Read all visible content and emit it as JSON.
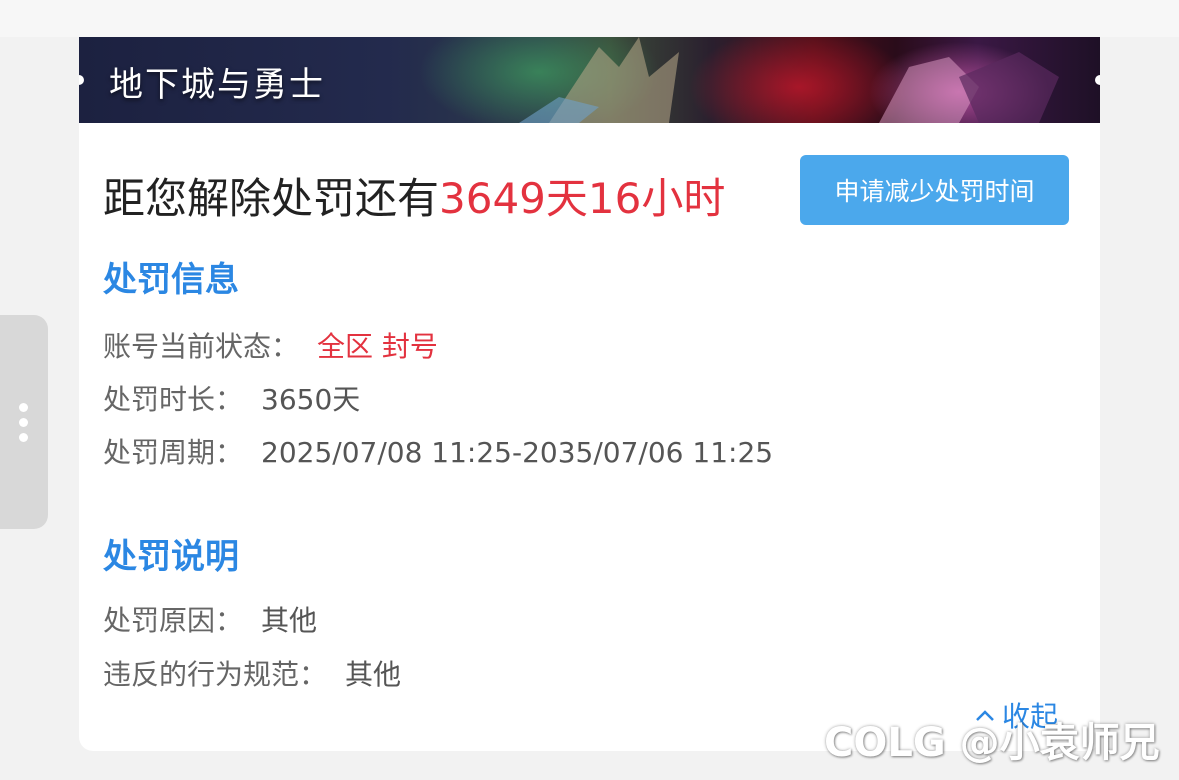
{
  "banner": {
    "title": "地下城与勇士"
  },
  "countdown": {
    "prefix": "距您解除处罚还有",
    "remaining": "3649天16小时"
  },
  "reduce_button": {
    "label": "申请减少处罚时间"
  },
  "penalty_info": {
    "title": "处罚信息",
    "rows": [
      {
        "label": "账号当前状态：",
        "value": "全区 封号"
      },
      {
        "label": "处罚时长：",
        "value": "3650天"
      },
      {
        "label": "处罚周期：",
        "value": "2025/07/08 11:25-2035/07/06 11:25"
      }
    ]
  },
  "penalty_desc": {
    "title": "处罚说明",
    "rows": [
      {
        "label": "处罚原因：",
        "value": "其他"
      },
      {
        "label": "违反的行为规范：",
        "value": "其他"
      }
    ]
  },
  "collapse": {
    "label": "收起",
    "icon": "chevron-up-icon"
  },
  "watermark": {
    "text": "COLG @小袁师兄"
  },
  "colors": {
    "accent_blue": "#2b87e3",
    "button_blue": "#4ba8ec",
    "alert_red": "#e3323f"
  }
}
